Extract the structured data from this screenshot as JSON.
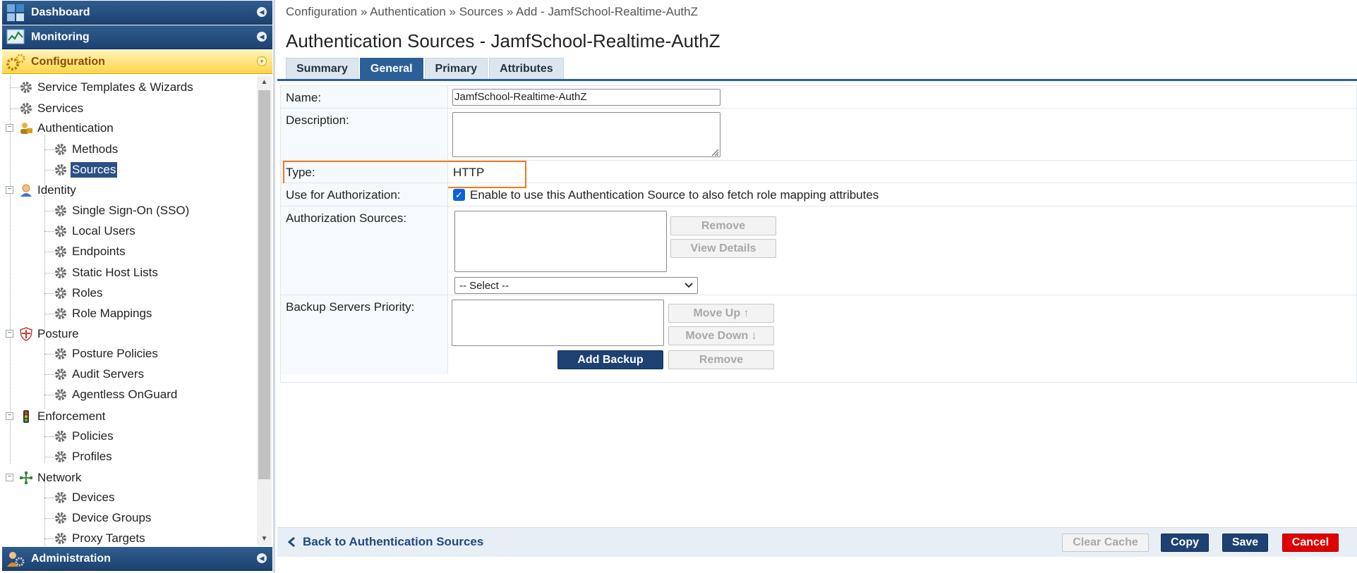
{
  "sidebar": {
    "accordions": [
      {
        "label": "Dashboard",
        "icon": "dashboard-icon"
      },
      {
        "label": "Monitoring",
        "icon": "monitoring-icon"
      },
      {
        "label": "Configuration",
        "icon": "configuration-icon"
      },
      {
        "label": "Administration",
        "icon": "administration-icon"
      }
    ],
    "tree": {
      "service_templates": "Service Templates & Wizards",
      "services": "Services",
      "authentication": "Authentication",
      "methods": "Methods",
      "sources": "Sources",
      "identity": "Identity",
      "sso": "Single Sign-On (SSO)",
      "local_users": "Local Users",
      "endpoints": "Endpoints",
      "static_host_lists": "Static Host Lists",
      "roles": "Roles",
      "role_mappings": "Role Mappings",
      "posture": "Posture",
      "posture_policies": "Posture Policies",
      "audit_servers": "Audit Servers",
      "agentless_onguard": "Agentless OnGuard",
      "enforcement": "Enforcement",
      "policies": "Policies",
      "profiles": "Profiles",
      "network": "Network",
      "devices": "Devices",
      "device_groups": "Device Groups",
      "proxy_targets": "Proxy Targets"
    },
    "colors": {
      "accordion": "#1c4270",
      "active_accordion": "#ffd54a",
      "selected": "#2c4f86"
    }
  },
  "main": {
    "breadcrumb": "Configuration » Authentication » Sources » Add - JamfSchool-Realtime-AuthZ",
    "title": "Authentication Sources - JamfSchool-Realtime-AuthZ",
    "tabs": [
      {
        "label": "Summary"
      },
      {
        "label": "General"
      },
      {
        "label": "Primary"
      },
      {
        "label": "Attributes"
      }
    ],
    "active_tab": "General",
    "form": {
      "name_label": "Name:",
      "name_value": "JamfSchool-Realtime-AuthZ",
      "description_label": "Description:",
      "description_value": "",
      "type_label": "Type:",
      "type_value": "HTTP",
      "use_for_auth_label": "Use for Authorization:",
      "use_for_auth_checked": true,
      "use_for_auth_text": "Enable to use this Authentication Source to also fetch role mapping attributes",
      "auth_sources_label": "Authorization Sources:",
      "remove_label": "Remove",
      "view_details_label": "View Details",
      "select_value": "-- Select --",
      "backup_label": "Backup Servers Priority:",
      "move_up_label": "Move Up ↑",
      "move_down_label": "Move Down ↓",
      "add_backup_label": "Add Backup",
      "backup_remove_label": "Remove"
    },
    "footer": {
      "back_label": "Back to Authentication Sources",
      "clear_cache_label": "Clear Cache",
      "copy_label": "Copy",
      "save_label": "Save",
      "cancel_label": "Cancel"
    },
    "colors": {
      "primary": "#1d4173",
      "tab_active": "#2c5f97",
      "cancel": "#e00000",
      "highlight": "#f07a20"
    }
  }
}
